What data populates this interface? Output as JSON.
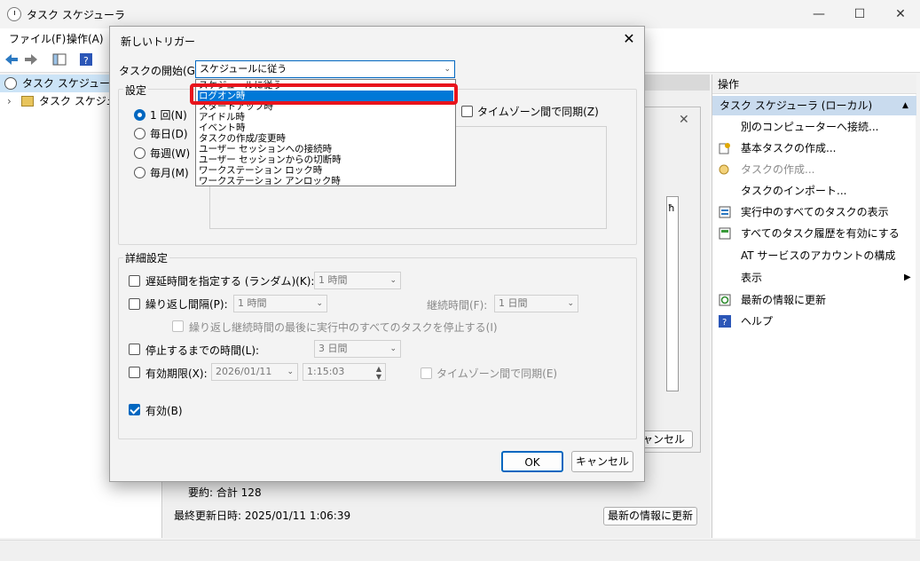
{
  "app": {
    "title": "タスク スケジューラ",
    "menu": [
      "ファイル(F)",
      "操作(A)"
    ]
  },
  "tree": {
    "root": "タスク スケジューラ (ロ",
    "library": "タスク スケジュー"
  },
  "center": {
    "summary": "要約: 合計 128",
    "last_updated": "最終更新日時: 2025/01/11 1:06:39",
    "refresh_button": "最新の情報に更新",
    "bg_cancel": "ャンセル",
    "bg_col_char": "ħ"
  },
  "actions": {
    "header": "操作",
    "section": "タスク スケジューラ (ローカル)",
    "items": [
      {
        "label": "別のコンピューターへ接続...",
        "icon": "none"
      },
      {
        "label": "基本タスクの作成...",
        "icon": "basic-task-icon"
      },
      {
        "label": "タスクの作成...",
        "icon": "create-task-icon",
        "disabled": true
      },
      {
        "label": "タスクのインポート...",
        "icon": "none"
      },
      {
        "label": "実行中のすべてのタスクの表示",
        "icon": "running-tasks-icon"
      },
      {
        "label": "すべてのタスク履歴を有効にする",
        "icon": "history-icon"
      },
      {
        "label": "AT サービスのアカウントの構成",
        "icon": "none"
      },
      {
        "label": "表示",
        "icon": "none",
        "submenu": true
      },
      {
        "label": "最新の情報に更新",
        "icon": "refresh-icon"
      },
      {
        "label": "ヘルプ",
        "icon": "help-icon"
      }
    ]
  },
  "dialog": {
    "title": "新しいトリガー",
    "begin_label": "タスクの開始(G):",
    "begin_value": "スケジュールに従う",
    "settings_label": "設定",
    "radios": [
      "1 回(N)",
      "毎日(D)",
      "毎週(W)",
      "毎月(M)"
    ],
    "timezone_sync": "タイムゾーン間で同期(Z)",
    "advanced_label": "詳細設定",
    "delay_label": "遅延時間を指定する (ランダム)(K):",
    "delay_value": "1 時間",
    "repeat_label": "繰り返し間隔(P):",
    "repeat_value": "1 時間",
    "duration_label": "継続時間(F):",
    "duration_value": "1 日間",
    "stop_all_label": "繰り返し継続時間の最後に実行中のすべてのタスクを停止する(I)",
    "stop_after_label": "停止するまでの時間(L):",
    "stop_after_value": "3 日間",
    "expire_label": "有効期限(X):",
    "expire_date": "2026/01/11",
    "expire_time": "1:15:03",
    "expire_tz": "タイムゾーン間で同期(E)",
    "enabled_label": "有効(B)",
    "ok": "OK",
    "cancel": "キャンセル"
  },
  "dropdown": {
    "items": [
      "スケジュールに従う",
      "ログオン時",
      "スタートアップ時",
      "アイドル時",
      "イベント時",
      "タスクの作成/変更時",
      "ユーザー セッションへの接続時",
      "ユーザー セッションからの切断時",
      "ワークステーション ロック時",
      "ワークステーション アンロック時"
    ],
    "selected_index": 1
  },
  "colors": {
    "highlight": "#e8141c",
    "selection": "#0078d7",
    "accent": "#0067c0"
  }
}
